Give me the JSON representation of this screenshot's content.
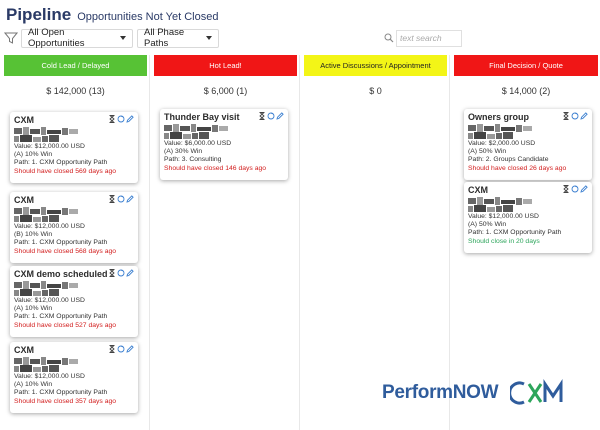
{
  "header": {
    "title": "Pipeline",
    "subtitle": "Opportunities Not Yet Closed"
  },
  "filters": {
    "open_opportunities": "All Open Opportunities",
    "phase_paths": "All Phase Paths",
    "search_placeholder": "text search"
  },
  "colors": {
    "green": "#57c235",
    "red": "#f01616",
    "yellow": "#f3f517",
    "overdue": "#d21d1d",
    "ontrack": "#2da55b"
  },
  "columns": [
    {
      "title": "Cold Lead / Delayed",
      "color": "#57c235",
      "total": "$ 142,000 (13)",
      "cards": [
        {
          "title": "CXM",
          "value": "Value: $12,000.00 USD",
          "win": "(A) 10% Win",
          "path": "Path: 1. CXM Opportunity Path",
          "status": "Should have closed 569 days ago",
          "status_type": "overdue"
        },
        {
          "title": "CXM",
          "value": "Value: $12,000.00 USD",
          "win": "(B) 10% Win",
          "path": "Path: 1. CXM Opportunity Path",
          "status": "Should have closed 568 days ago",
          "status_type": "overdue"
        },
        {
          "title": "CXM demo scheduled",
          "value": "Value: $12,000.00 USD",
          "win": "(A) 10% Win",
          "path": "Path: 1. CXM Opportunity Path",
          "status": "Should have closed 527 days ago",
          "status_type": "overdue"
        },
        {
          "title": "CXM",
          "value": "Value: $12,000.00 USD",
          "win": "(A) 10% Win",
          "path": "Path: 1. CXM Opportunity Path",
          "status": "Should have closed 357 days ago",
          "status_type": "overdue"
        }
      ]
    },
    {
      "title": "Hot Lead!",
      "color": "#f01616",
      "total": "$ 6,000 (1)",
      "cards": [
        {
          "title": "Thunder Bay visit",
          "value": "Value: $6,000.00 USD",
          "win": "(A) 30% Win",
          "path": "Path: 3. Consulting",
          "status": "Should have closed 146 days ago",
          "status_type": "overdue"
        }
      ]
    },
    {
      "title": "Active Discussions / Appointment",
      "color": "#f3f517",
      "total": "$ 0",
      "cards": []
    },
    {
      "title": "Final Decision / Quote",
      "color": "#f01616",
      "total": "$ 14,000 (2)",
      "cards": [
        {
          "title": "Owners group",
          "value": "Value: $2,000.00 USD",
          "win": "(A) 50% Win",
          "path": "Path: 2. Groups Candidate",
          "status": "Should have closed 26 days ago",
          "status_type": "overdue"
        },
        {
          "title": "CXM",
          "value": "Value: $12,000.00 USD",
          "win": "(A) 50% Win",
          "path": "Path: 1. CXM Opportunity Path",
          "status": "Should close in 20 days",
          "status_type": "ok"
        }
      ]
    }
  ],
  "logo": {
    "perform": "Perform",
    "now": "NOW",
    "cxm_text": "CXM"
  }
}
